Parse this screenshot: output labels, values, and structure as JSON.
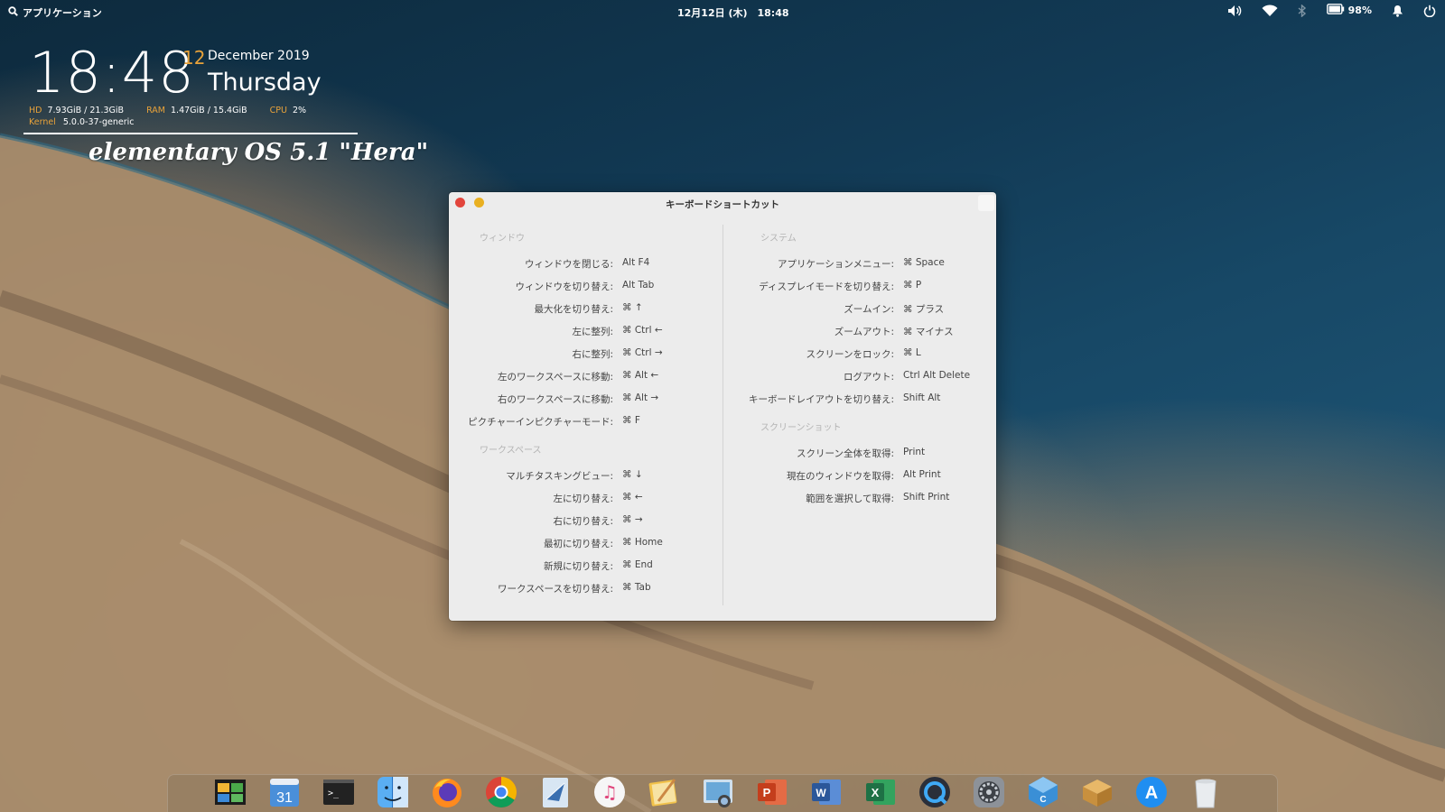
{
  "top_panel": {
    "apps_label": "アプリケーション",
    "clock": "12月12日 (木)　18:48",
    "battery": "98%"
  },
  "conky": {
    "time": "18:48",
    "day": "12",
    "month_year": "December 2019",
    "weekday": "Thursday",
    "hd_label": "HD",
    "hd_value": "7.93GiB / 21.3GiB",
    "ram_label": "RAM",
    "ram_value": "1.47GiB / 15.4GiB",
    "cpu_label": "CPU",
    "cpu_value": "2%",
    "kernel_label": "Kernel",
    "kernel_value": "5.0.0-37-generic",
    "os_name": "elementary OS 5.1 \"Hera\""
  },
  "dialog": {
    "title": "キーボードショートカット",
    "left": {
      "sections": [
        {
          "title": "ウィンドウ",
          "items": [
            {
              "label": "ウィンドウを閉じる:",
              "keys": "Alt  F4"
            },
            {
              "label": "ウィンドウを切り替え:",
              "keys": "Alt  Tab"
            },
            {
              "label": "最大化を切り替え:",
              "keys": "⌘  ↑"
            },
            {
              "label": "左に整列:",
              "keys": "⌘  Ctrl  ←"
            },
            {
              "label": "右に整列:",
              "keys": "⌘  Ctrl  →"
            },
            {
              "label": "左のワークスペースに移動:",
              "keys": "⌘  Alt  ←"
            },
            {
              "label": "右のワークスペースに移動:",
              "keys": "⌘  Alt  →"
            },
            {
              "label": "ピクチャーインピクチャーモード:",
              "keys": "⌘  F"
            }
          ]
        },
        {
          "title": "ワークスペース",
          "items": [
            {
              "label": "マルチタスキングビュー:",
              "keys": "⌘  ↓"
            },
            {
              "label": "左に切り替え:",
              "keys": "⌘  ←"
            },
            {
              "label": "右に切り替え:",
              "keys": "⌘  →"
            },
            {
              "label": "最初に切り替え:",
              "keys": "⌘  Home"
            },
            {
              "label": "新規に切り替え:",
              "keys": "⌘  End"
            },
            {
              "label": "ワークスペースを切り替え:",
              "keys": "⌘  Tab"
            }
          ]
        }
      ]
    },
    "right": {
      "sections": [
        {
          "title": "システム",
          "items": [
            {
              "label": "アプリケーションメニュー:",
              "keys": "⌘  Space"
            },
            {
              "label": "ディスプレイモードを切り替え:",
              "keys": "⌘  P"
            },
            {
              "label": "ズームイン:",
              "keys": "⌘  プラス"
            },
            {
              "label": "ズームアウト:",
              "keys": "⌘  マイナス"
            },
            {
              "label": "スクリーンをロック:",
              "keys": "⌘  L"
            },
            {
              "label": "ログアウト:",
              "keys": "Ctrl  Alt  Delete"
            },
            {
              "label": "キーボードレイアウトを切り替え:",
              "keys": "Shift  Alt"
            }
          ]
        },
        {
          "title": "スクリーンショット",
          "items": [
            {
              "label": "スクリーン全体を取得:",
              "keys": "Print"
            },
            {
              "label": "現在のウィンドウを取得:",
              "keys": "Alt  Print"
            },
            {
              "label": "範囲を選択して取得:",
              "keys": "Shift  Print"
            }
          ]
        }
      ]
    }
  },
  "dock": {
    "items": [
      {
        "name": "file-manager-icon",
        "glyph": ""
      },
      {
        "name": "calendar-icon",
        "glyph": "31"
      },
      {
        "name": "terminal-icon",
        "glyph": ">_"
      },
      {
        "name": "finder-icon",
        "glyph": ""
      },
      {
        "name": "firefox-icon",
        "glyph": ""
      },
      {
        "name": "chrome-icon",
        "glyph": ""
      },
      {
        "name": "mail-icon",
        "glyph": ""
      },
      {
        "name": "music-icon",
        "glyph": "♫"
      },
      {
        "name": "notes-icon",
        "glyph": ""
      },
      {
        "name": "image-viewer-icon",
        "glyph": ""
      },
      {
        "name": "powerpoint-icon",
        "glyph": "P"
      },
      {
        "name": "word-icon",
        "glyph": "W"
      },
      {
        "name": "excel-icon",
        "glyph": "X"
      },
      {
        "name": "quicktime-icon",
        "glyph": ""
      },
      {
        "name": "system-settings-icon",
        "glyph": ""
      },
      {
        "name": "code-editor-icon",
        "glyph": "C"
      },
      {
        "name": "package-installer-icon",
        "glyph": ""
      },
      {
        "name": "app-store-icon",
        "glyph": "A"
      },
      {
        "name": "trash-icon",
        "glyph": ""
      }
    ]
  }
}
